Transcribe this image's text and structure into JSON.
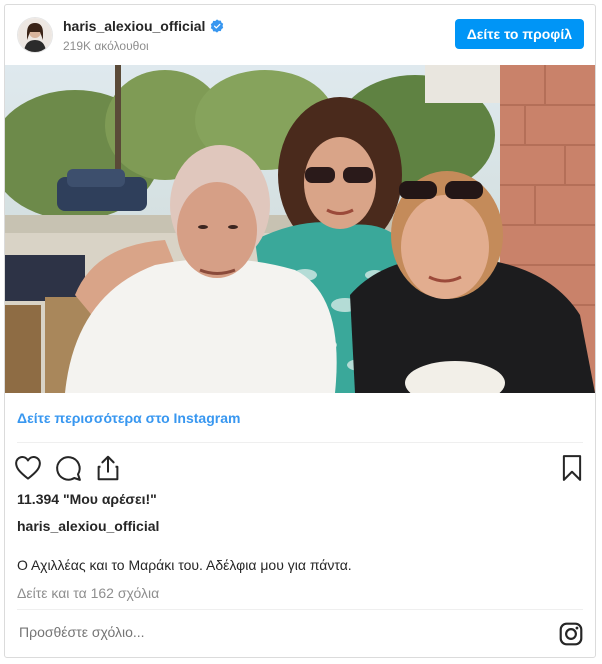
{
  "header": {
    "username": "haris_alexiou_official",
    "followers": "219K ακόλουθοι",
    "profile_button": "Δείτε το προφίλ",
    "avatar_icon": "profile-avatar"
  },
  "post": {
    "photo_icon": "photo-three-people",
    "more_link": "Δείτε περισσότερα στο Instagram",
    "likes": "11.394 \"Μου αρέσει!\"",
    "caption_username": "haris_alexiou_official",
    "caption": "Ο Αχιλλέας και το Μαράκι του. Αδέλφια μου για πάντα.",
    "comments_link": "Δείτε και τα 162 σχόλια",
    "comment_placeholder": "Προσθέστε σχόλιο..."
  },
  "icons": [
    "heart-icon",
    "comment-icon",
    "share-icon",
    "bookmark-icon",
    "instagram-icon",
    "verified-badge-icon"
  ],
  "colors": {
    "accent": "#0095f6",
    "link": "#3897f0",
    "muted": "#8e8e8e"
  }
}
